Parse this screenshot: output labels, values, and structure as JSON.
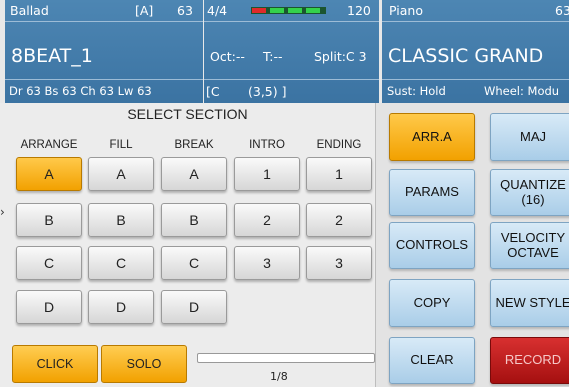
{
  "header": {
    "left": {
      "style": "Ballad",
      "bracket_a": "[A]",
      "tempo_value": "63",
      "name": "8BEAT_1",
      "info": "Dr 63  Bs 63  Ch 63  Lw 63"
    },
    "middle": {
      "time_sig": "4/4",
      "tempo": "120",
      "oct": "Oct:--",
      "transpose": "T:--",
      "split": "Split:C 3",
      "chord": "[C",
      "chord_info": "(3,5) ]",
      "meter_colors": {
        "on": "#34d24c",
        "accent": "#e02a2a"
      }
    },
    "right": {
      "category": "Piano",
      "cat_number": "63",
      "voice": "CLASSIC GRAND",
      "sust": "Sust: Hold",
      "wheel": "Wheel: Modu"
    }
  },
  "section": {
    "title": "SELECT SECTION",
    "columns": [
      "ARRANGE",
      "FILL",
      "BREAK",
      "INTRO",
      "ENDING"
    ],
    "arrange": [
      "A",
      "B",
      "C",
      "D"
    ],
    "fill": [
      "A",
      "B",
      "C",
      "D"
    ],
    "break": [
      "A",
      "B",
      "C",
      "D"
    ],
    "intro": [
      "1",
      "2",
      "3"
    ],
    "ending": [
      "1",
      "2",
      "3"
    ],
    "selected_arrange": "A"
  },
  "bottom": {
    "click": "CLICK",
    "solo": "SOLO",
    "progress_label": "1/8",
    "progress_fraction": 0.0
  },
  "right_panel": {
    "arr": "ARR.A",
    "maj": "MAJ",
    "params": "PARAMS",
    "quantize": "QUANTIZE\n(16)",
    "controls": "CONTROLS",
    "velocity": "VELOCITY\nOCTAVE",
    "copy": "COPY",
    "new_style": "NEW STYLE",
    "clear": "CLEAR",
    "record": "RECORD"
  },
  "colors": {
    "header_blue": "#3b73a2",
    "selected_orange": "#f2a100",
    "button_blue": "#a9cde8",
    "record_red": "#a51010"
  },
  "left_marker": "›"
}
